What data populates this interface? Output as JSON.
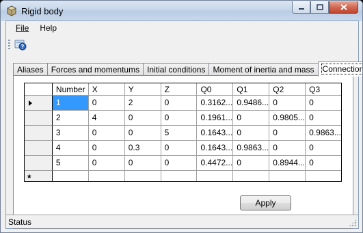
{
  "window": {
    "title": "Rigid body"
  },
  "menu": {
    "file": "File",
    "help": "Help"
  },
  "tabs": [
    {
      "label": "Aliases"
    },
    {
      "label": "Forces and momentums"
    },
    {
      "label": "Initial conditions"
    },
    {
      "label": "Moment of inertia and mass"
    },
    {
      "label": "Connections"
    }
  ],
  "active_tab": "Connections",
  "grid": {
    "columns": [
      "Number",
      "X",
      "Y",
      "Z",
      "Q0",
      "Q1",
      "Q2",
      "Q3"
    ],
    "rows": [
      [
        "1",
        "0",
        "2",
        "0",
        "0.3162...",
        "0.9486...",
        "0",
        "0"
      ],
      [
        "2",
        "4",
        "0",
        "0",
        "0.1961...",
        "0",
        "0.9805...",
        "0"
      ],
      [
        "3",
        "0",
        "0",
        "5",
        "0.1643...",
        "0",
        "0",
        "0.9863..."
      ],
      [
        "4",
        "0",
        "0.3",
        "0",
        "0.1643...",
        "0.9863...",
        "0",
        "0"
      ],
      [
        "5",
        "0",
        "0",
        "0",
        "0.4472...",
        "0",
        "0.8944...",
        "0"
      ]
    ],
    "new_row_marker": "*"
  },
  "apply_label": "Apply",
  "status": "Status",
  "icons": {
    "app": "cube-icon",
    "help_tool": "help-icon",
    "current_row": "row-pointer-icon"
  }
}
